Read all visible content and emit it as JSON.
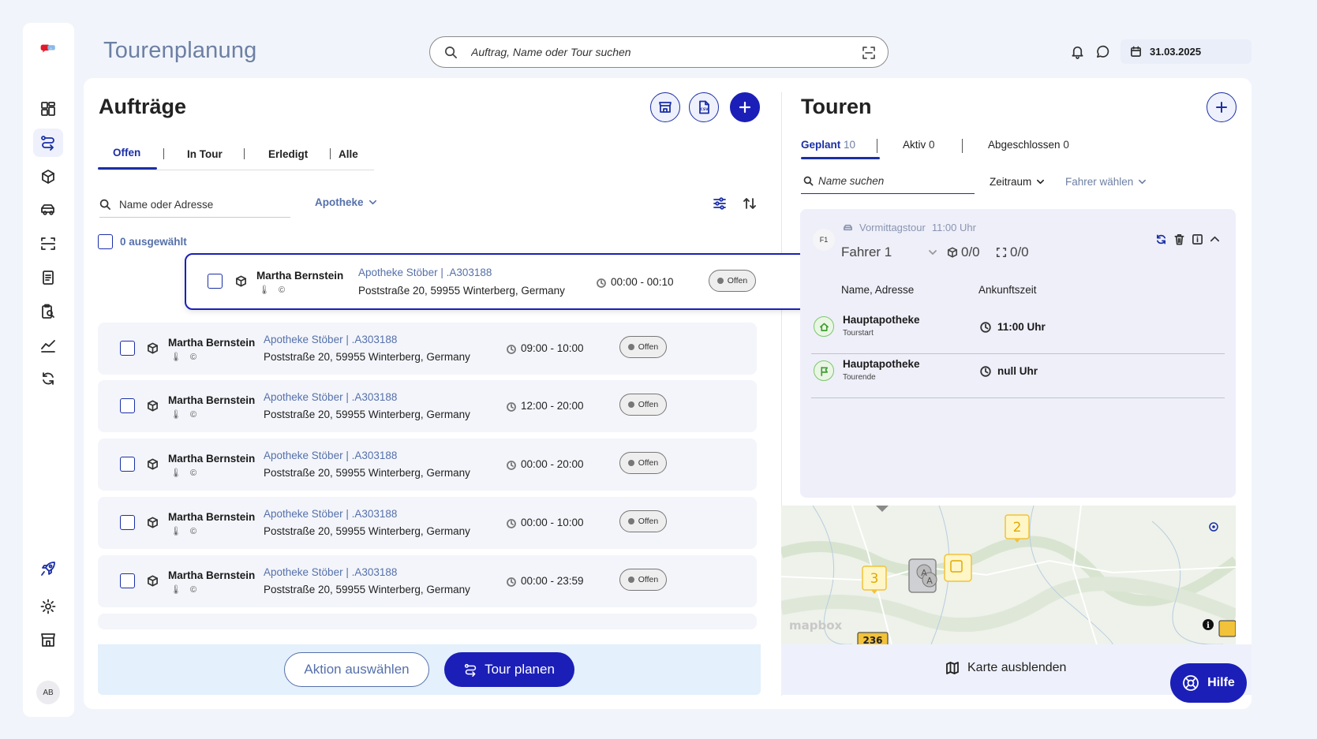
{
  "header": {
    "title": "Tourenplanung",
    "search_placeholder": "Auftrag, Name oder Tour suchen",
    "date": "31.03.2025"
  },
  "sidebar": {
    "avatar_initials": "AB",
    "items": [
      "dashboard-icon",
      "routes-icon",
      "package-icon",
      "truck-icon",
      "scan-icon",
      "document-icon",
      "report-search-icon",
      "chart-icon",
      "sync-icon",
      "rocket-icon",
      "gear-icon",
      "store-icon"
    ]
  },
  "orders": {
    "title": "Aufträge",
    "tabs": [
      "Offen",
      "In Tour",
      "Erledigt",
      "Alle"
    ],
    "search_placeholder": "Name oder Adresse",
    "pharmacy_filter": "Apotheke",
    "selected_count": "0 ausgewählt",
    "dragged": {
      "name": "Martha Bernstein",
      "subicons": "🌡 ©",
      "pharmacy": "Apotheke Stöber | .A303188",
      "address": "Poststraße 20, 59955 Winterberg, Germany",
      "time": "00:00 - 00:10",
      "status": "Offen"
    },
    "rows": [
      {
        "name": "Martha Bernstein",
        "subicons": "🌡 ©",
        "pharmacy": "Apotheke Stöber | .A303188",
        "address": "Poststraße 20, 59955 Winterberg, Germany",
        "time": "09:00 - 10:00",
        "status": "Offen"
      },
      {
        "name": "Martha Bernstein",
        "subicons": "🌡 ©",
        "pharmacy": "Apotheke Stöber | .A303188",
        "address": "Poststraße 20, 59955 Winterberg, Germany",
        "time": "12:00 - 20:00",
        "status": "Offen"
      },
      {
        "name": "Martha Bernstein",
        "subicons": "🌡 ©",
        "pharmacy": "Apotheke Stöber | .A303188",
        "address": "Poststraße 20, 59955 Winterberg, Germany",
        "time": "00:00 - 20:00",
        "status": "Offen"
      },
      {
        "name": "Martha Bernstein",
        "subicons": "🌡 ©",
        "pharmacy": "Apotheke Stöber | .A303188",
        "address": "Poststraße 20, 59955 Winterberg, Germany",
        "time": "00:00 - 10:00",
        "status": "Offen"
      },
      {
        "name": "Martha Bernstein",
        "subicons": "🌡 ©",
        "pharmacy": "Apotheke Stöber | .A303188",
        "address": "Poststraße 20, 59955 Winterberg, Germany",
        "time": "00:00 - 23:59",
        "status": "Offen"
      }
    ],
    "action_select_label": "Aktion auswählen",
    "plan_tour_label": "Tour planen"
  },
  "tours": {
    "title": "Touren",
    "tabs": [
      {
        "label": "Geplant",
        "count": "10"
      },
      {
        "label": "Aktiv",
        "count": "0"
      },
      {
        "label": "Abgeschlossen",
        "count": "0"
      }
    ],
    "search_placeholder": "Name suchen",
    "period_filter": "Zeitraum",
    "driver_filter": "Fahrer wählen",
    "card": {
      "avatar": "F1",
      "tour_name": "Vormittagstour",
      "tour_time": "11:00 Uhr",
      "driver": "Fahrer 1",
      "package_count": "0/0",
      "stop_count": "0/0",
      "col_name": "Name, Adresse",
      "col_arrival": "Ankunftszeit",
      "stops": [
        {
          "name": "Hauptapotheke",
          "type": "Tourstart",
          "time": "11:00 Uhr",
          "icon": "home-icon"
        },
        {
          "name": "Hauptapotheke",
          "type": "Tourende",
          "time": "null Uhr",
          "icon": "flag-icon"
        }
      ]
    },
    "map": {
      "attribution": "mapbox",
      "markers": [
        "2",
        "3"
      ],
      "road_label": "236"
    },
    "hide_map_label": "Karte ausblenden"
  },
  "help_label": "Hilfe",
  "colors": {
    "primary": "#1b1fb8",
    "accent_text": "#5570aa",
    "success": "#7cc76c"
  }
}
